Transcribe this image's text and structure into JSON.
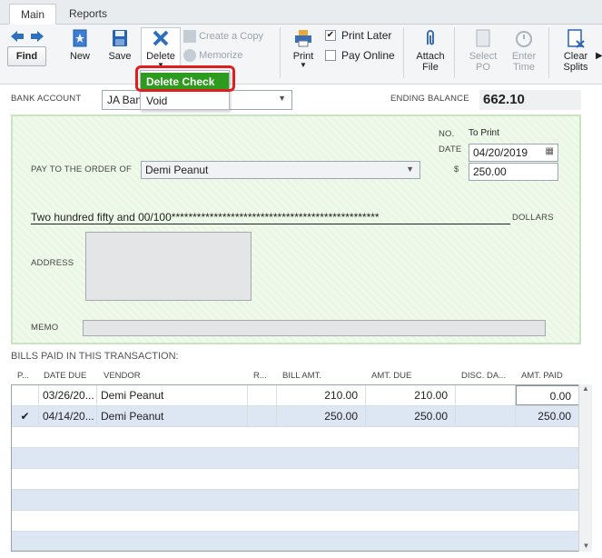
{
  "tabs": [
    "Main",
    "Reports"
  ],
  "toolbar": {
    "find": "Find",
    "new": "New",
    "save": "Save",
    "delete": "Delete",
    "create_copy": "Create a Copy",
    "memorize": "Memorize",
    "print": "Print",
    "print_later": "Print Later",
    "pay_online": "Pay Online",
    "attach_file_1": "Attach",
    "attach_file_2": "File",
    "select_po_1": "Select",
    "select_po_2": "PO",
    "enter_time_1": "Enter",
    "enter_time_2": "Time",
    "clear_splits_1": "Clear",
    "clear_splits_2": "Splits"
  },
  "menu": {
    "delete_check": "Delete Check",
    "void": "Void"
  },
  "header": {
    "bank_account_label": "BANK ACCOUNT",
    "bank_account_value": "JA Ban",
    "ending_balance_label": "ENDING BALANCE",
    "ending_balance_value": "662.10"
  },
  "check": {
    "no_label": "NO.",
    "no_value": "To Print",
    "date_label": "DATE",
    "date_value": "04/20/2019",
    "amount_label": "$",
    "amount_value": "250.00",
    "payee_label": "PAY TO THE ORDER OF",
    "payee_value": "Demi Peanut",
    "written_amount": "Two hundred fifty and 00/100*************************************************",
    "dollars": "DOLLARS",
    "address_label": "ADDRESS",
    "memo_label": "MEMO"
  },
  "bills_title": "BILLS PAID IN THIS TRANSACTION:",
  "grid": {
    "headers": [
      "P...",
      "DATE DUE",
      "VENDOR",
      "R...",
      "BILL AMT.",
      "AMT. DUE",
      "DISC. DA...",
      "AMT. PAID"
    ],
    "rows": [
      {
        "paid": "",
        "date_due": "03/26/20...",
        "vendor": "Demi Peanut",
        "ref": "",
        "bill_amt": "210.00",
        "amt_due": "210.00",
        "disc": "",
        "amt_paid": "0.00"
      },
      {
        "paid": "✔",
        "date_due": "04/14/20...",
        "vendor": "Demi Peanut",
        "ref": "",
        "bill_amt": "250.00",
        "amt_due": "250.00",
        "disc": "",
        "amt_paid": "250.00"
      }
    ]
  }
}
